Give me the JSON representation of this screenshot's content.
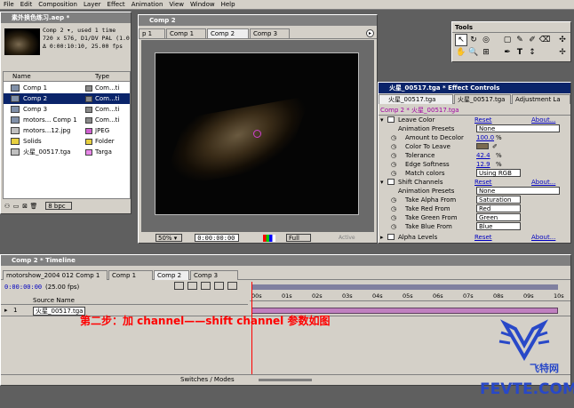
{
  "menu": [
    "File",
    "Edit",
    "Composition",
    "Layer",
    "Effect",
    "Animation",
    "View",
    "Window",
    "Help"
  ],
  "project": {
    "title": "素外换色练习.aep *",
    "comp_name": "Comp 2 ▾, used 1 time",
    "comp_size": "720 x 576, D1/DV PAL (1.0",
    "comp_dur": "Δ 0:00:10:10, 25.00 fps",
    "col_name": "Name",
    "col_type": "Type",
    "items": [
      {
        "name": "Comp 1",
        "type": "Com...ti",
        "icon": "comp",
        "label": "#888888",
        "sel": false
      },
      {
        "name": "Comp 2",
        "type": "Com...ti",
        "icon": "comp",
        "label": "#888888",
        "sel": true
      },
      {
        "name": "Comp 3",
        "type": "Com...ti",
        "icon": "comp",
        "label": "#888888",
        "sel": false
      },
      {
        "name": "motors... Comp 1",
        "type": "Com...ti",
        "icon": "comp",
        "label": "#888888",
        "sel": false
      },
      {
        "name": "motors...12.jpg",
        "type": "JPEG",
        "icon": "img",
        "label": "#d060d0",
        "sel": false
      },
      {
        "name": "Solids",
        "type": "Folder",
        "icon": "folder",
        "label": "#e8d040",
        "sel": false
      },
      {
        "name": "火星_00517.tga",
        "type": "Targa",
        "icon": "img",
        "label": "#e888e8",
        "sel": false
      }
    ],
    "bpc": "8 bpc"
  },
  "comp_window": {
    "title": "Comp 2",
    "tabs": [
      "p 1",
      "Comp 1",
      "Comp 2",
      "Comp 3"
    ],
    "zoom": "50% ▾",
    "timecode": "0:00:00:00",
    "res": "Full",
    "active": "Active"
  },
  "tools": {
    "title": "Tools"
  },
  "effects": {
    "title": "火星_00517.tga * Effect Controls",
    "tabs": [
      "火星_00517.tga",
      "火星_00517.tga",
      "Adjustment La"
    ],
    "breadcrumb": "Comp 2 * 火星_00517.tga",
    "leave_color": {
      "name": "Leave Color",
      "reset": "Reset",
      "about": "About...",
      "props": [
        {
          "label": "Animation Presets",
          "kind": "select",
          "value": "None"
        },
        {
          "label": "Amount to Decolor",
          "kind": "num",
          "value": "100.0",
          "unit": "%"
        },
        {
          "label": "Color To Leave",
          "kind": "color",
          "value": ""
        },
        {
          "label": "Tolerance",
          "kind": "num",
          "value": "42.4",
          "unit": "%"
        },
        {
          "label": "Edge Softness",
          "kind": "num",
          "value": "12.9",
          "unit": "%"
        },
        {
          "label": "Match colors",
          "kind": "select",
          "value": "Using RGB"
        }
      ]
    },
    "shift_channels": {
      "name": "Shift Channels",
      "reset": "Reset",
      "about": "About...",
      "props": [
        {
          "label": "Animation Presets",
          "kind": "select",
          "value": "None"
        },
        {
          "label": "Take Alpha From",
          "kind": "select",
          "value": "Saturation"
        },
        {
          "label": "Take Red From",
          "kind": "select",
          "value": "Red"
        },
        {
          "label": "Take Green From",
          "kind": "select",
          "value": "Green"
        },
        {
          "label": "Take Blue From",
          "kind": "select",
          "value": "Blue"
        }
      ]
    },
    "alpha_levels": {
      "name": "Alpha Levels",
      "reset": "Reset",
      "about": "About..."
    }
  },
  "timeline": {
    "title": "Comp 2 * Timeline",
    "tabs": [
      "motorshow_2004 012 Comp 1",
      "Comp 1",
      "Comp 2",
      "Comp 3"
    ],
    "timecode": "0:00:00:00",
    "fps": "(25.00 fps)",
    "col_source": "Source Name",
    "layer_num": "1",
    "layer_name": "火星_00517.tga",
    "switches": "Switches / Modes",
    "ticks": [
      "00s",
      "01s",
      "02s",
      "03s",
      "04s",
      "05s",
      "06s",
      "07s",
      "08s",
      "09s",
      "10s"
    ]
  },
  "annotation": "第二步：加 channel——shift channel 参数如图",
  "watermark": {
    "brand": "飞特网",
    "site": "FEVTE.COM"
  },
  "colors": {
    "title_active": "#0a246a",
    "panel": "#d4d0c8",
    "annotation": "#ff0000",
    "work_area": "#c080c0",
    "watermark": "#2848c8"
  }
}
